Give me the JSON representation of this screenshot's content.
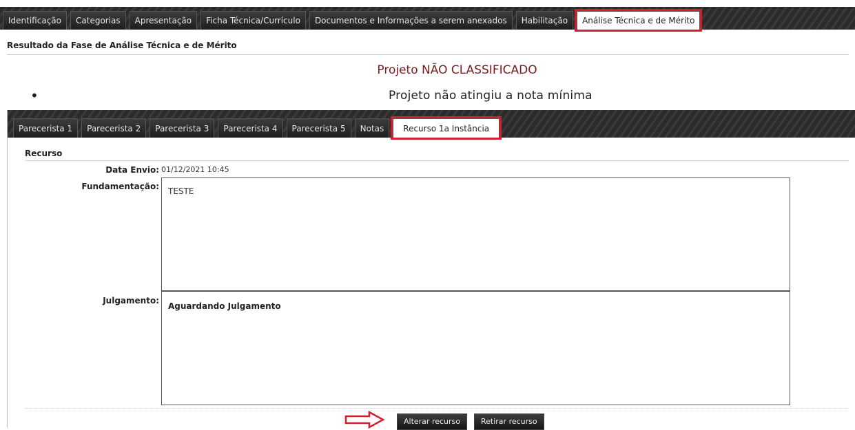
{
  "top_tabs": [
    {
      "label": "Identificação"
    },
    {
      "label": "Categorias"
    },
    {
      "label": "Apresentação"
    },
    {
      "label": "Ficha Técnica/Currículo"
    },
    {
      "label": "Documentos e Informações a serem anexados"
    },
    {
      "label": "Habilitação"
    },
    {
      "label": "Análise Técnica e de Mérito",
      "active": true
    }
  ],
  "section_title": "Resultado da Fase de Análise Técnica e de Mérito",
  "status": "Projeto NÃO CLASSIFICADO",
  "reason": "Projeto não atingiu a nota mínima",
  "inner_tabs": [
    {
      "label": "Parecerista 1"
    },
    {
      "label": "Parecerista 2"
    },
    {
      "label": "Parecerista 3"
    },
    {
      "label": "Parecerista 4"
    },
    {
      "label": "Parecerista 5"
    },
    {
      "label": "Notas"
    },
    {
      "label": "Recurso 1a Instância",
      "active": true
    }
  ],
  "recurso": {
    "heading": "Recurso",
    "data_envio_label": "Data Envio:",
    "data_envio_value": "01/12/2021 10:45",
    "fundamentacao_label": "Fundamentação:",
    "fundamentacao_value": "TESTE",
    "julgamento_label": "Julgamento:",
    "julgamento_value": "Aguardando Julgamento"
  },
  "buttons": {
    "alterar": "Alterar recurso",
    "retirar": "Retirar recurso"
  },
  "colors": {
    "highlight": "#d21f2b",
    "status_text": "#7b1c1c",
    "tab_bar": "#2b2b2b"
  },
  "icons": {
    "arrow": "right-arrow-icon"
  }
}
